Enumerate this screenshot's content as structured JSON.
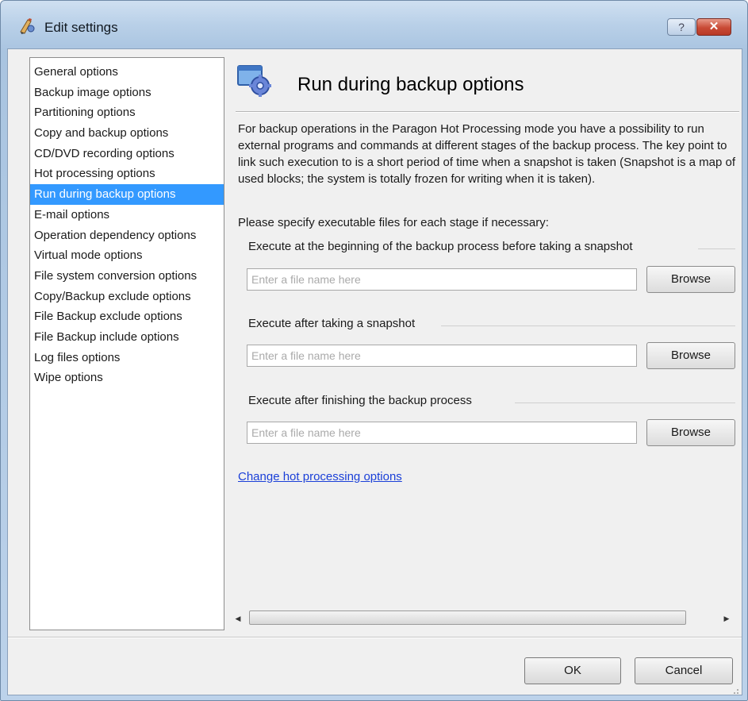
{
  "window": {
    "title": "Edit settings",
    "icon": "edit-settings-icon",
    "help_label": "?",
    "close_label": "✕"
  },
  "sidebar": {
    "items": [
      {
        "label": "General options"
      },
      {
        "label": "Backup image options"
      },
      {
        "label": "Partitioning options"
      },
      {
        "label": "Copy and backup options"
      },
      {
        "label": "CD/DVD recording options"
      },
      {
        "label": "Hot processing options"
      },
      {
        "label": "Run during backup options"
      },
      {
        "label": "E-mail options"
      },
      {
        "label": "Operation dependency options"
      },
      {
        "label": "Virtual mode options"
      },
      {
        "label": "File system conversion options"
      },
      {
        "label": "Copy/Backup exclude options"
      },
      {
        "label": "File Backup exclude options"
      },
      {
        "label": "File Backup include options"
      },
      {
        "label": "Log files options"
      },
      {
        "label": "Wipe options"
      }
    ],
    "selected": "Run during backup options"
  },
  "content": {
    "icon": "settings-gear-icon",
    "title": "Run during backup options",
    "description": "For backup operations in the Paragon Hot Processing mode you have a possibility to run external programs and commands at different stages of the backup process. The key point to link such execution to is a short period of time when a snapshot is taken (Snapshot is a map of used blocks; the system is totally frozen for writing when it is taken).",
    "specify_label": "Please specify executable files for each stage if necessary:",
    "stages": [
      {
        "label": "Execute at the beginning of the backup process before taking a snapshot",
        "placeholder": "Enter a file name here",
        "value": "",
        "browse_label": "Browse"
      },
      {
        "label": "Execute after taking a snapshot",
        "placeholder": "Enter a file name here",
        "value": "",
        "browse_label": "Browse"
      },
      {
        "label": "Execute after finishing the backup process",
        "placeholder": "Enter a file name here",
        "value": "",
        "browse_label": "Browse"
      }
    ],
    "link_label": "Change hot processing options",
    "scrollbar_left": "◀",
    "scrollbar_right": "▶"
  },
  "footer": {
    "ok_label": "OK",
    "cancel_label": "Cancel"
  },
  "colors": {
    "selection": "#3399ff",
    "link": "#1a3fd8",
    "close_button": "#c94a35"
  }
}
